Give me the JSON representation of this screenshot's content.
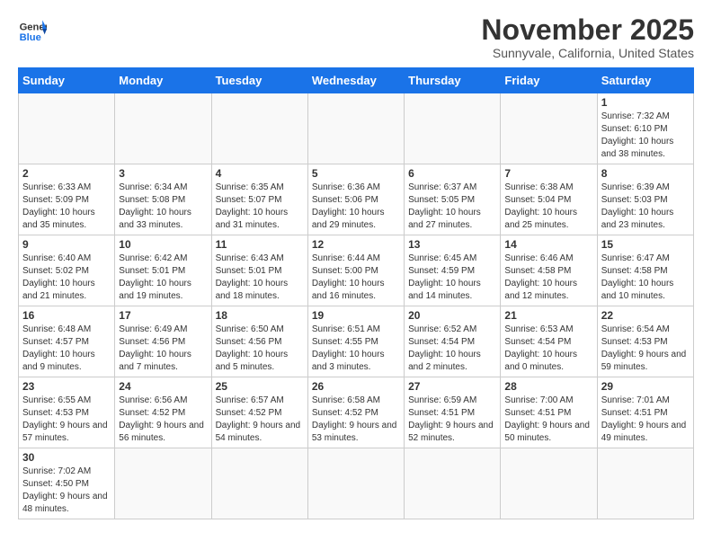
{
  "header": {
    "logo_general": "General",
    "logo_blue": "Blue",
    "month_title": "November 2025",
    "location": "Sunnyvale, California, United States"
  },
  "days_of_week": [
    "Sunday",
    "Monday",
    "Tuesday",
    "Wednesday",
    "Thursday",
    "Friday",
    "Saturday"
  ],
  "weeks": [
    [
      {
        "day": "",
        "info": ""
      },
      {
        "day": "",
        "info": ""
      },
      {
        "day": "",
        "info": ""
      },
      {
        "day": "",
        "info": ""
      },
      {
        "day": "",
        "info": ""
      },
      {
        "day": "",
        "info": ""
      },
      {
        "day": "1",
        "info": "Sunrise: 7:32 AM\nSunset: 6:10 PM\nDaylight: 10 hours and 38 minutes."
      }
    ],
    [
      {
        "day": "2",
        "info": "Sunrise: 6:33 AM\nSunset: 5:09 PM\nDaylight: 10 hours and 35 minutes."
      },
      {
        "day": "3",
        "info": "Sunrise: 6:34 AM\nSunset: 5:08 PM\nDaylight: 10 hours and 33 minutes."
      },
      {
        "day": "4",
        "info": "Sunrise: 6:35 AM\nSunset: 5:07 PM\nDaylight: 10 hours and 31 minutes."
      },
      {
        "day": "5",
        "info": "Sunrise: 6:36 AM\nSunset: 5:06 PM\nDaylight: 10 hours and 29 minutes."
      },
      {
        "day": "6",
        "info": "Sunrise: 6:37 AM\nSunset: 5:05 PM\nDaylight: 10 hours and 27 minutes."
      },
      {
        "day": "7",
        "info": "Sunrise: 6:38 AM\nSunset: 5:04 PM\nDaylight: 10 hours and 25 minutes."
      },
      {
        "day": "8",
        "info": "Sunrise: 6:39 AM\nSunset: 5:03 PM\nDaylight: 10 hours and 23 minutes."
      }
    ],
    [
      {
        "day": "9",
        "info": "Sunrise: 6:40 AM\nSunset: 5:02 PM\nDaylight: 10 hours and 21 minutes."
      },
      {
        "day": "10",
        "info": "Sunrise: 6:42 AM\nSunset: 5:01 PM\nDaylight: 10 hours and 19 minutes."
      },
      {
        "day": "11",
        "info": "Sunrise: 6:43 AM\nSunset: 5:01 PM\nDaylight: 10 hours and 18 minutes."
      },
      {
        "day": "12",
        "info": "Sunrise: 6:44 AM\nSunset: 5:00 PM\nDaylight: 10 hours and 16 minutes."
      },
      {
        "day": "13",
        "info": "Sunrise: 6:45 AM\nSunset: 4:59 PM\nDaylight: 10 hours and 14 minutes."
      },
      {
        "day": "14",
        "info": "Sunrise: 6:46 AM\nSunset: 4:58 PM\nDaylight: 10 hours and 12 minutes."
      },
      {
        "day": "15",
        "info": "Sunrise: 6:47 AM\nSunset: 4:58 PM\nDaylight: 10 hours and 10 minutes."
      }
    ],
    [
      {
        "day": "16",
        "info": "Sunrise: 6:48 AM\nSunset: 4:57 PM\nDaylight: 10 hours and 9 minutes."
      },
      {
        "day": "17",
        "info": "Sunrise: 6:49 AM\nSunset: 4:56 PM\nDaylight: 10 hours and 7 minutes."
      },
      {
        "day": "18",
        "info": "Sunrise: 6:50 AM\nSunset: 4:56 PM\nDaylight: 10 hours and 5 minutes."
      },
      {
        "day": "19",
        "info": "Sunrise: 6:51 AM\nSunset: 4:55 PM\nDaylight: 10 hours and 3 minutes."
      },
      {
        "day": "20",
        "info": "Sunrise: 6:52 AM\nSunset: 4:54 PM\nDaylight: 10 hours and 2 minutes."
      },
      {
        "day": "21",
        "info": "Sunrise: 6:53 AM\nSunset: 4:54 PM\nDaylight: 10 hours and 0 minutes."
      },
      {
        "day": "22",
        "info": "Sunrise: 6:54 AM\nSunset: 4:53 PM\nDaylight: 9 hours and 59 minutes."
      }
    ],
    [
      {
        "day": "23",
        "info": "Sunrise: 6:55 AM\nSunset: 4:53 PM\nDaylight: 9 hours and 57 minutes."
      },
      {
        "day": "24",
        "info": "Sunrise: 6:56 AM\nSunset: 4:52 PM\nDaylight: 9 hours and 56 minutes."
      },
      {
        "day": "25",
        "info": "Sunrise: 6:57 AM\nSunset: 4:52 PM\nDaylight: 9 hours and 54 minutes."
      },
      {
        "day": "26",
        "info": "Sunrise: 6:58 AM\nSunset: 4:52 PM\nDaylight: 9 hours and 53 minutes."
      },
      {
        "day": "27",
        "info": "Sunrise: 6:59 AM\nSunset: 4:51 PM\nDaylight: 9 hours and 52 minutes."
      },
      {
        "day": "28",
        "info": "Sunrise: 7:00 AM\nSunset: 4:51 PM\nDaylight: 9 hours and 50 minutes."
      },
      {
        "day": "29",
        "info": "Sunrise: 7:01 AM\nSunset: 4:51 PM\nDaylight: 9 hours and 49 minutes."
      }
    ],
    [
      {
        "day": "30",
        "info": "Sunrise: 7:02 AM\nSunset: 4:50 PM\nDaylight: 9 hours and 48 minutes."
      },
      {
        "day": "",
        "info": ""
      },
      {
        "day": "",
        "info": ""
      },
      {
        "day": "",
        "info": ""
      },
      {
        "day": "",
        "info": ""
      },
      {
        "day": "",
        "info": ""
      },
      {
        "day": "",
        "info": ""
      }
    ]
  ]
}
